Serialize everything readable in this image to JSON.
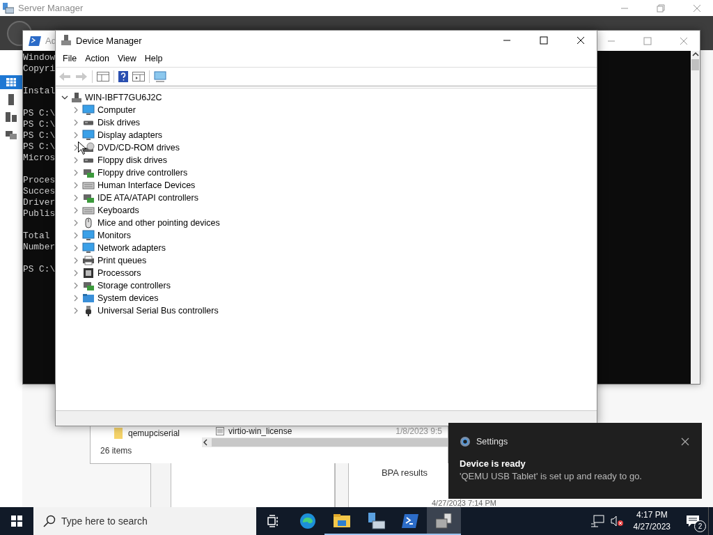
{
  "server_manager": {
    "title": "Server Manager",
    "sidebar_items": [
      {
        "kind": "dashboard",
        "selected": true
      },
      {
        "kind": "server",
        "selected": false
      },
      {
        "kind": "servers",
        "selected": false
      },
      {
        "kind": "file-services",
        "selected": false
      }
    ],
    "explorer": {
      "nav_items": [
        {
          "label": "qemupciserial"
        }
      ],
      "file_name": "virtio-win_license",
      "file_date": "1/8/2023 9:5",
      "status": "26 items"
    },
    "tiles": [
      {
        "label": "BPA results"
      }
    ],
    "timestamp": "4/27/2023 7:14 PM"
  },
  "console_window": {
    "title": "Ad",
    "blocks": [
      [
        "Window",
        "Copyri"
      ],
      [
        "Instal"
      ],
      [
        "PS C:\\",
        "PS C:\\",
        "PS C:\\",
        "PS C:\\",
        "Micros"
      ],
      [
        "Proces",
        "Succes",
        "Driver",
        "Publis"
      ],
      [
        "Total",
        "Number"
      ],
      [
        "PS C:\\"
      ]
    ]
  },
  "device_manager": {
    "title": "Device Manager",
    "menu": [
      "File",
      "Action",
      "View",
      "Help"
    ],
    "toolbar": [
      {
        "kind": "back",
        "disabled": true
      },
      {
        "kind": "forward",
        "disabled": true
      },
      {
        "kind": "console-tree",
        "disabled": false
      },
      {
        "kind": "help",
        "disabled": false
      },
      {
        "kind": "action-pane",
        "disabled": false
      },
      {
        "kind": "scan",
        "disabled": false
      }
    ],
    "tree": [
      {
        "label": "WIN-IBFT7GU6J2C",
        "kind": "host",
        "expanded": true,
        "children": [
          {
            "label": "Computer",
            "kind": "monitor",
            "expanded": false
          },
          {
            "label": "Disk drives",
            "kind": "drive",
            "expanded": false
          },
          {
            "label": "Display adapters",
            "kind": "monitor",
            "expanded": false
          },
          {
            "label": "DVD/CD-ROM drives",
            "kind": "disc",
            "expanded": false
          },
          {
            "label": "Floppy disk drives",
            "kind": "drive",
            "expanded": false
          },
          {
            "label": "Floppy drive controllers",
            "kind": "card",
            "expanded": false
          },
          {
            "label": "Human Interface Devices",
            "kind": "keyboard",
            "expanded": false
          },
          {
            "label": "IDE ATA/ATAPI controllers",
            "kind": "card",
            "expanded": false
          },
          {
            "label": "Keyboards",
            "kind": "keyboard",
            "expanded": false
          },
          {
            "label": "Mice and other pointing devices",
            "kind": "mouse",
            "expanded": false
          },
          {
            "label": "Monitors",
            "kind": "monitor",
            "expanded": false
          },
          {
            "label": "Network adapters",
            "kind": "monitor",
            "expanded": false
          },
          {
            "label": "Print queues",
            "kind": "printer",
            "expanded": false
          },
          {
            "label": "Processors",
            "kind": "chip",
            "expanded": false
          },
          {
            "label": "Storage controllers",
            "kind": "card",
            "expanded": false
          },
          {
            "label": "System devices",
            "kind": "folder",
            "expanded": false
          },
          {
            "label": "Universal Serial Bus controllers",
            "kind": "usb",
            "expanded": false
          }
        ]
      }
    ]
  },
  "notification": {
    "app": "Settings",
    "title": "Device is ready",
    "body": "'QEMU USB Tablet' is set up and ready to go."
  },
  "taskbar": {
    "search": {
      "placeholder": "Type here to search"
    },
    "apps": [
      {
        "kind": "task-view",
        "running": false,
        "selected": false
      },
      {
        "kind": "browser",
        "running": false,
        "selected": false
      },
      {
        "kind": "folder",
        "running": true,
        "selected": false
      },
      {
        "kind": "server",
        "running": true,
        "selected": false
      },
      {
        "kind": "terminal",
        "running": true,
        "selected": false
      },
      {
        "kind": "device-manager",
        "running": true,
        "selected": true
      }
    ],
    "time": "4:17 PM",
    "date": "4/27/2023",
    "notification_count": "2"
  }
}
